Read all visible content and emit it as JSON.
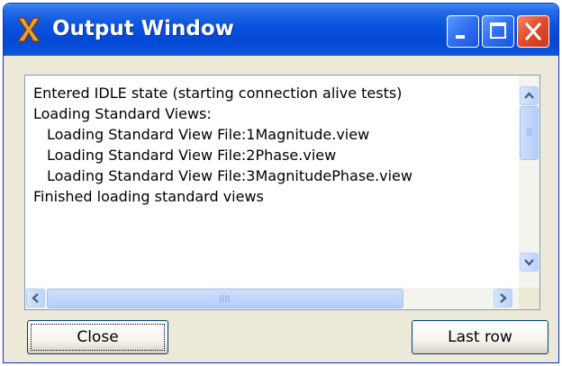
{
  "window": {
    "title": "Output Window",
    "icon": "app-x-icon"
  },
  "titlebar_buttons": [
    "minimize-icon",
    "maximize-icon",
    "close-icon"
  ],
  "output": {
    "lines": [
      "Entered IDLE state (starting connection alive tests)",
      "Loading Standard Views:",
      "Loading Standard View File:1Magnitude.view",
      "Loading Standard View File:2Phase.view",
      "Loading Standard View File:3MagnitudePhase.view",
      "Finished loading standard views"
    ]
  },
  "buttons": {
    "close_label": "Close",
    "last_row_label": "Last row"
  },
  "colors": {
    "titlebar": "#0a55df",
    "window_bg": "#ece9d8",
    "close_button": "#e04a2a"
  }
}
